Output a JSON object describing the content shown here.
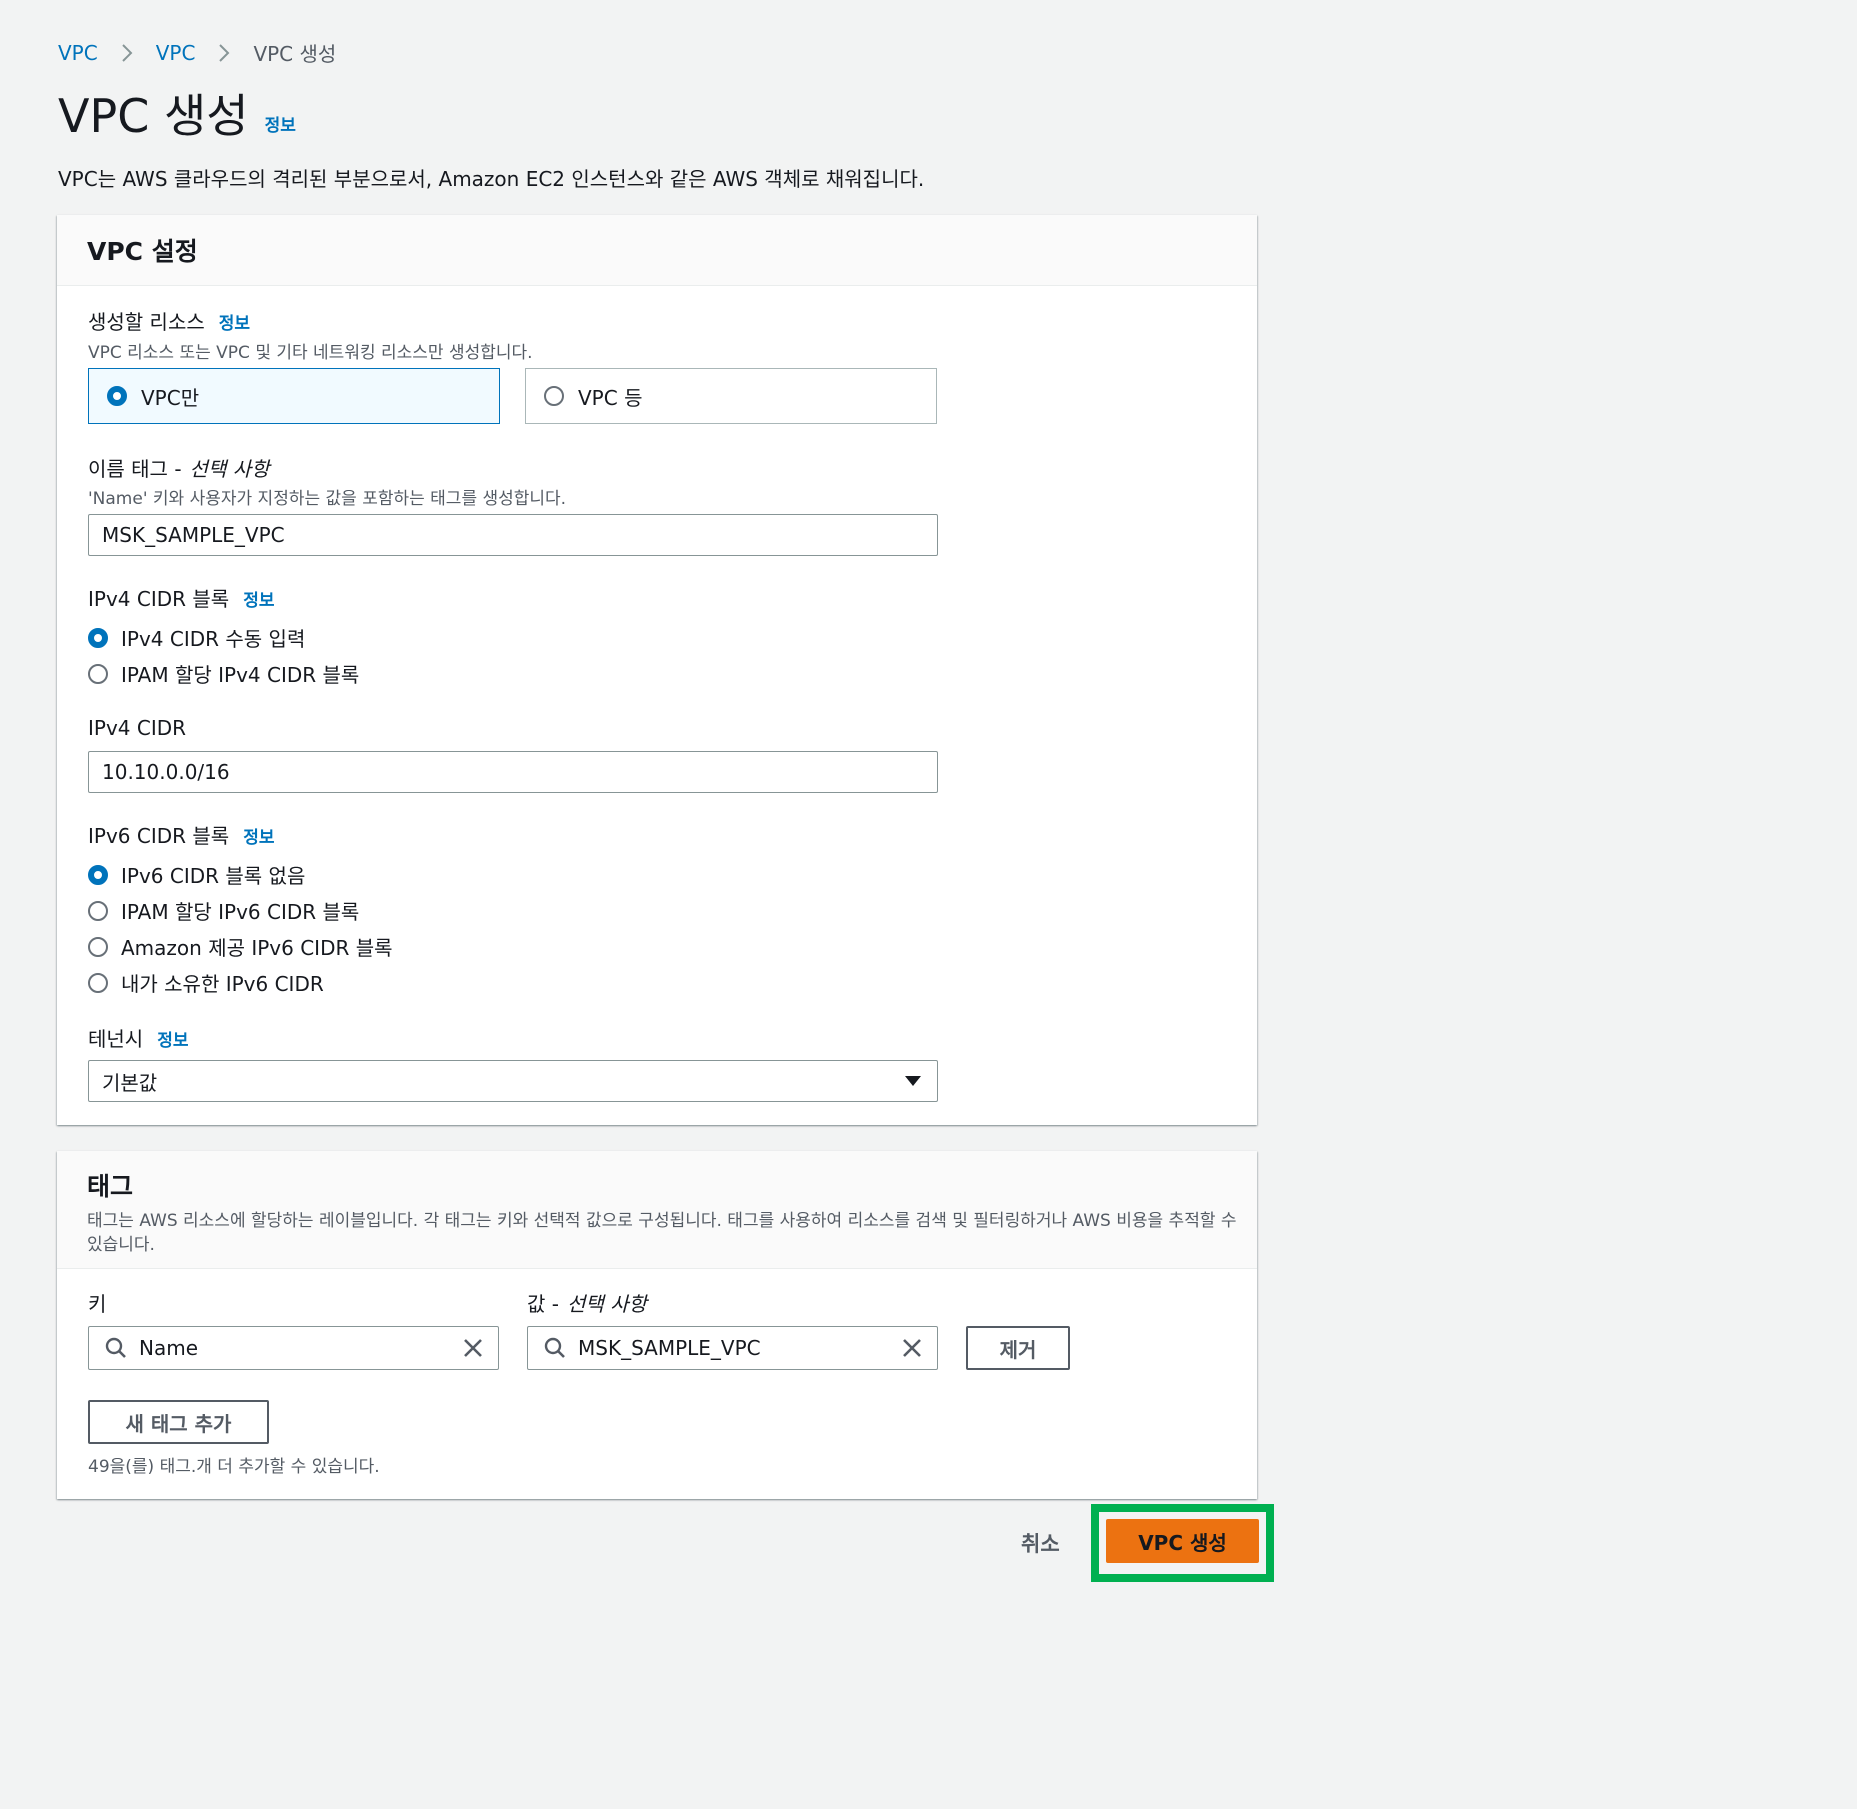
{
  "breadcrumb": {
    "item1": "VPC",
    "item2": "VPC",
    "current": "VPC 생성"
  },
  "page": {
    "title": "VPC 생성",
    "info": "정보",
    "description": "VPC는 AWS 클라우드의 격리된 부분으로서, Amazon EC2 인스턴스와 같은 AWS 객체로 채워집니다."
  },
  "vpc_settings": {
    "title": "VPC 설정",
    "resources": {
      "label": "생성할 리소스",
      "info": "정보",
      "hint": "VPC 리소스 또는 VPC 및 기타 네트워킹 리소스만 생성합니다.",
      "option_vpc_only": "VPC만",
      "option_vpc_more": "VPC 등"
    },
    "name_tag": {
      "label": "이름 태그 -",
      "optional": "선택 사항",
      "hint": "'Name' 키와 사용자가 지정하는 값을 포함하는 태그를 생성합니다.",
      "value": "MSK_SAMPLE_VPC"
    },
    "ipv4_block": {
      "label": "IPv4 CIDR 블록",
      "info": "정보",
      "option_manual": "IPv4 CIDR 수동 입력",
      "option_ipam": "IPAM 할당 IPv4 CIDR 블록"
    },
    "ipv4_cidr": {
      "label": "IPv4 CIDR",
      "value": "10.10.0.0/16"
    },
    "ipv6_block": {
      "label": "IPv6 CIDR 블록",
      "info": "정보",
      "option_none": "IPv6 CIDR 블록 없음",
      "option_ipam": "IPAM 할당 IPv6 CIDR 블록",
      "option_amazon": "Amazon 제공 IPv6 CIDR 블록",
      "option_owned": "내가 소유한 IPv6 CIDR"
    },
    "tenancy": {
      "label": "테넌시",
      "info": "정보",
      "value": "기본값"
    }
  },
  "tags": {
    "title": "태그",
    "description": "태그는 AWS 리소스에 할당하는 레이블입니다. 각 태그는 키와 선택적 값으로 구성됩니다. 태그를 사용하여 리소스를 검색 및 필터링하거나 AWS 비용을 추적할 수 있습니다.",
    "key_label": "키",
    "value_label": "값 -",
    "value_optional": "선택 사항",
    "key_value": "Name",
    "value_value": "MSK_SAMPLE_VPC",
    "remove_button": "제거",
    "add_button": "새 태그 추가",
    "remaining_hint": "49을(를) 태그.개 더 추가할 수 있습니다."
  },
  "footer": {
    "cancel": "취소",
    "create": "VPC 생성"
  },
  "colors": {
    "link": "#0073bb",
    "primary": "#ec7211",
    "highlight": "#00b050",
    "background": "#f2f3f3"
  }
}
